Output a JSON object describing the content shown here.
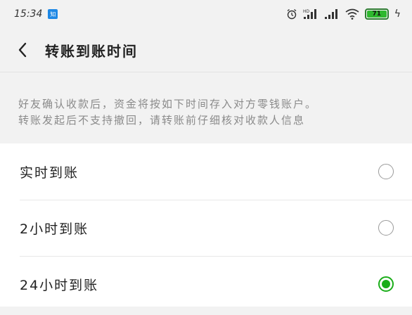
{
  "status_bar": {
    "time": "15:34",
    "app_badge": "知",
    "alarm_icon": "alarm-icon",
    "hd_signal": "HD",
    "wifi_icon": "wifi-icon",
    "battery_level": "71",
    "charging_icon": "charging-icon"
  },
  "header": {
    "title": "转账到账时间",
    "back_icon": "chevron-left-icon"
  },
  "notice": {
    "line1": "好友确认收款后，资金将按如下时间存入对方零钱账户。",
    "line2": "转账发起后不支持撤回，请转账前仔细核对收款人信息"
  },
  "options": [
    {
      "label": "实时到账",
      "selected": false
    },
    {
      "label": "2小时到账",
      "selected": false
    },
    {
      "label": "24小时到账",
      "selected": true
    }
  ],
  "colors": {
    "accent": "#1aad19",
    "background": "#f2f2f2",
    "muted_text": "#8a8a8a"
  }
}
